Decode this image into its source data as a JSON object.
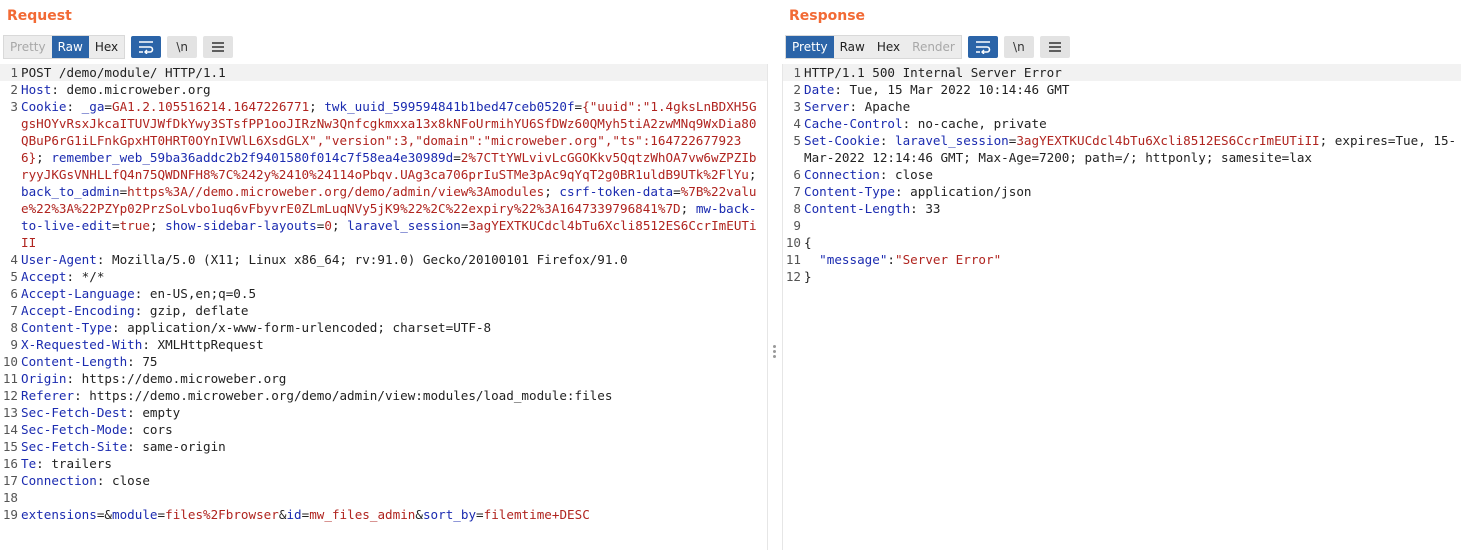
{
  "request": {
    "title": "Request",
    "view_buttons": [
      "Pretty",
      "Raw",
      "Hex"
    ],
    "active_view": "Raw",
    "newline_label": "\\n",
    "request_line": "POST /demo/module/ HTTP/1.1",
    "host": {
      "key": "Host",
      "value": "demo.microweber.org"
    },
    "cookie_key": "Cookie",
    "cookies": [
      {
        "name": "_ga",
        "value": "GA1.2.105516214.1647226771"
      },
      {
        "name": "twk_uuid_599594841b1bed47ceb0520f",
        "value": "{\"uuid\":\"1.4gksLnBDXH5GgsHOYvRsxJkcaITUVJWfDkYwy3STsfPP1ooJIRzNw3Qnfcgkmxxa13x8kNFoUrmihYU6SfDWz60QMyh5tiA2zwMNq9WxDia80QBuP6rG1iLFnkGpxHT0HRT0OYnIVWlL6XsdGLX\",\"version\":3,\"domain\":\"microweber.org\",\"ts\":1647226779236}"
      },
      {
        "name": "remember_web_59ba36addc2b2f9401580f014c7f58ea4e30989d",
        "value": "2%7CTtYWLvivLcGGOKkv5QqtzWhOA7vw6wZPZIbryyJKGsVNHLLfQ4n75QWDNFH8%7C%242y%2410%24114oPbqv.UAg3ca706prIuSTMe3pAc9qYqT2g0BR1uldB9UTk%2FlYu"
      },
      {
        "name": "back_to_admin",
        "value": "https%3A//demo.microweber.org/demo/admin/view%3Amodules"
      },
      {
        "name": "csrf-token-data",
        "value": "%7B%22value%22%3A%22PZYp02PrzSoLvbo1uq6vFbyvrE0ZLmLuqNVy5jK9%22%2C%22expiry%22%3A1647339796841%7D"
      },
      {
        "name": "mw-back-to-live-edit",
        "value": "true"
      },
      {
        "name": "show-sidebar-layouts",
        "value": "0"
      },
      {
        "name": "laravel_session",
        "value": "3agYEXTKUCdcl4bTu6Xcli8512ES6CcrImEUTiII"
      }
    ],
    "headers": [
      {
        "key": "User-Agent",
        "value": "Mozilla/5.0 (X11; Linux x86_64; rv:91.0) Gecko/20100101 Firefox/91.0"
      },
      {
        "key": "Accept",
        "value": "*/*"
      },
      {
        "key": "Accept-Language",
        "value": "en-US,en;q=0.5"
      },
      {
        "key": "Accept-Encoding",
        "value": "gzip, deflate"
      },
      {
        "key": "Content-Type",
        "value": "application/x-www-form-urlencoded; charset=UTF-8"
      },
      {
        "key": "X-Requested-With",
        "value": "XMLHttpRequest"
      },
      {
        "key": "Content-Length",
        "value": "75"
      },
      {
        "key": "Origin",
        "value": "https://demo.microweber.org"
      },
      {
        "key": "Referer",
        "value": "https://demo.microweber.org/demo/admin/view:modules/load_module:files"
      },
      {
        "key": "Sec-Fetch-Dest",
        "value": "empty"
      },
      {
        "key": "Sec-Fetch-Mode",
        "value": "cors"
      },
      {
        "key": "Sec-Fetch-Site",
        "value": "same-origin"
      },
      {
        "key": "Te",
        "value": "trailers"
      },
      {
        "key": "Connection",
        "value": "close"
      }
    ],
    "body_params": [
      {
        "name": "extensions",
        "value": ""
      },
      {
        "name": "module",
        "value": "files%2Fbrowser"
      },
      {
        "name": "id",
        "value": "mw_files_admin"
      },
      {
        "name": "sort_by",
        "value": "filemtime+DESC"
      }
    ]
  },
  "response": {
    "title": "Response",
    "view_buttons": [
      "Pretty",
      "Raw",
      "Hex",
      "Render"
    ],
    "active_view": "Pretty",
    "newline_label": "\\n",
    "status_line": "HTTP/1.1 500 Internal Server Error",
    "headers": [
      {
        "key": "Date",
        "value": "Tue, 15 Mar 2022 10:14:46 GMT"
      },
      {
        "key": "Server",
        "value": "Apache"
      },
      {
        "key": "Cache-Control",
        "value": "no-cache, private"
      }
    ],
    "set_cookie": {
      "key": "Set-Cookie",
      "name": "laravel_session",
      "value": "3agYEXTKUCdcl4bTu6Xcli8512ES6CcrImEUTiII",
      "attrs": "; expires=Tue, 15-Mar-2022 12:14:46 GMT; Max-Age=7200; path=/; httponly; samesite=lax"
    },
    "headers2": [
      {
        "key": "Connection",
        "value": "close"
      },
      {
        "key": "Content-Type",
        "value": "application/json"
      },
      {
        "key": "Content-Length",
        "value": "33"
      }
    ],
    "body": {
      "open": "{",
      "key": "\"message\"",
      "value": "\"Server Error\"",
      "close": "}"
    }
  },
  "colors": {
    "accent": "#f26a35",
    "active": "#2b64a8",
    "header_key": "#1b2bb0",
    "value": "#b0241f"
  }
}
